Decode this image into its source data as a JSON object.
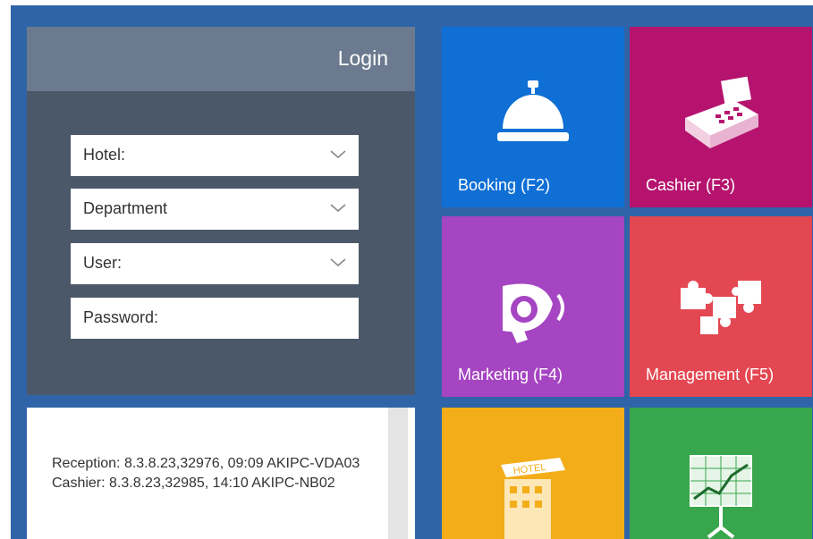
{
  "login": {
    "title": "Login",
    "hotel_label": "Hotel:",
    "department_label": "Department",
    "user_label": "User:",
    "password_label": "Password:"
  },
  "info": {
    "lines": [
      "Reception: 8.3.8.23,32976, 09:09 AKIPC-VDA03",
      "Cashier: 8.3.8.23,32985, 14:10 AKIPC-NB02"
    ]
  },
  "tiles": [
    {
      "label": "Booking  (F2)",
      "color": "#0f6fd4",
      "icon": "service-bell-icon"
    },
    {
      "label": "Cashier (F3)",
      "color": "#b5136e",
      "icon": "cash-register-icon"
    },
    {
      "label": "Marketing (F4)",
      "color": "#a545c2",
      "icon": "megaphone-icon"
    },
    {
      "label": "Management (F5)",
      "color": "#e34752",
      "icon": "puzzle-icon"
    },
    {
      "label": "",
      "color": "#f3ad19",
      "icon": "hotel-building-icon"
    },
    {
      "label": "",
      "color": "#38a64c",
      "icon": "chart-board-icon"
    }
  ],
  "colors": {
    "background": "#2f64a8",
    "login_panel": "#4b5869",
    "login_header": "#6b7a8e"
  }
}
